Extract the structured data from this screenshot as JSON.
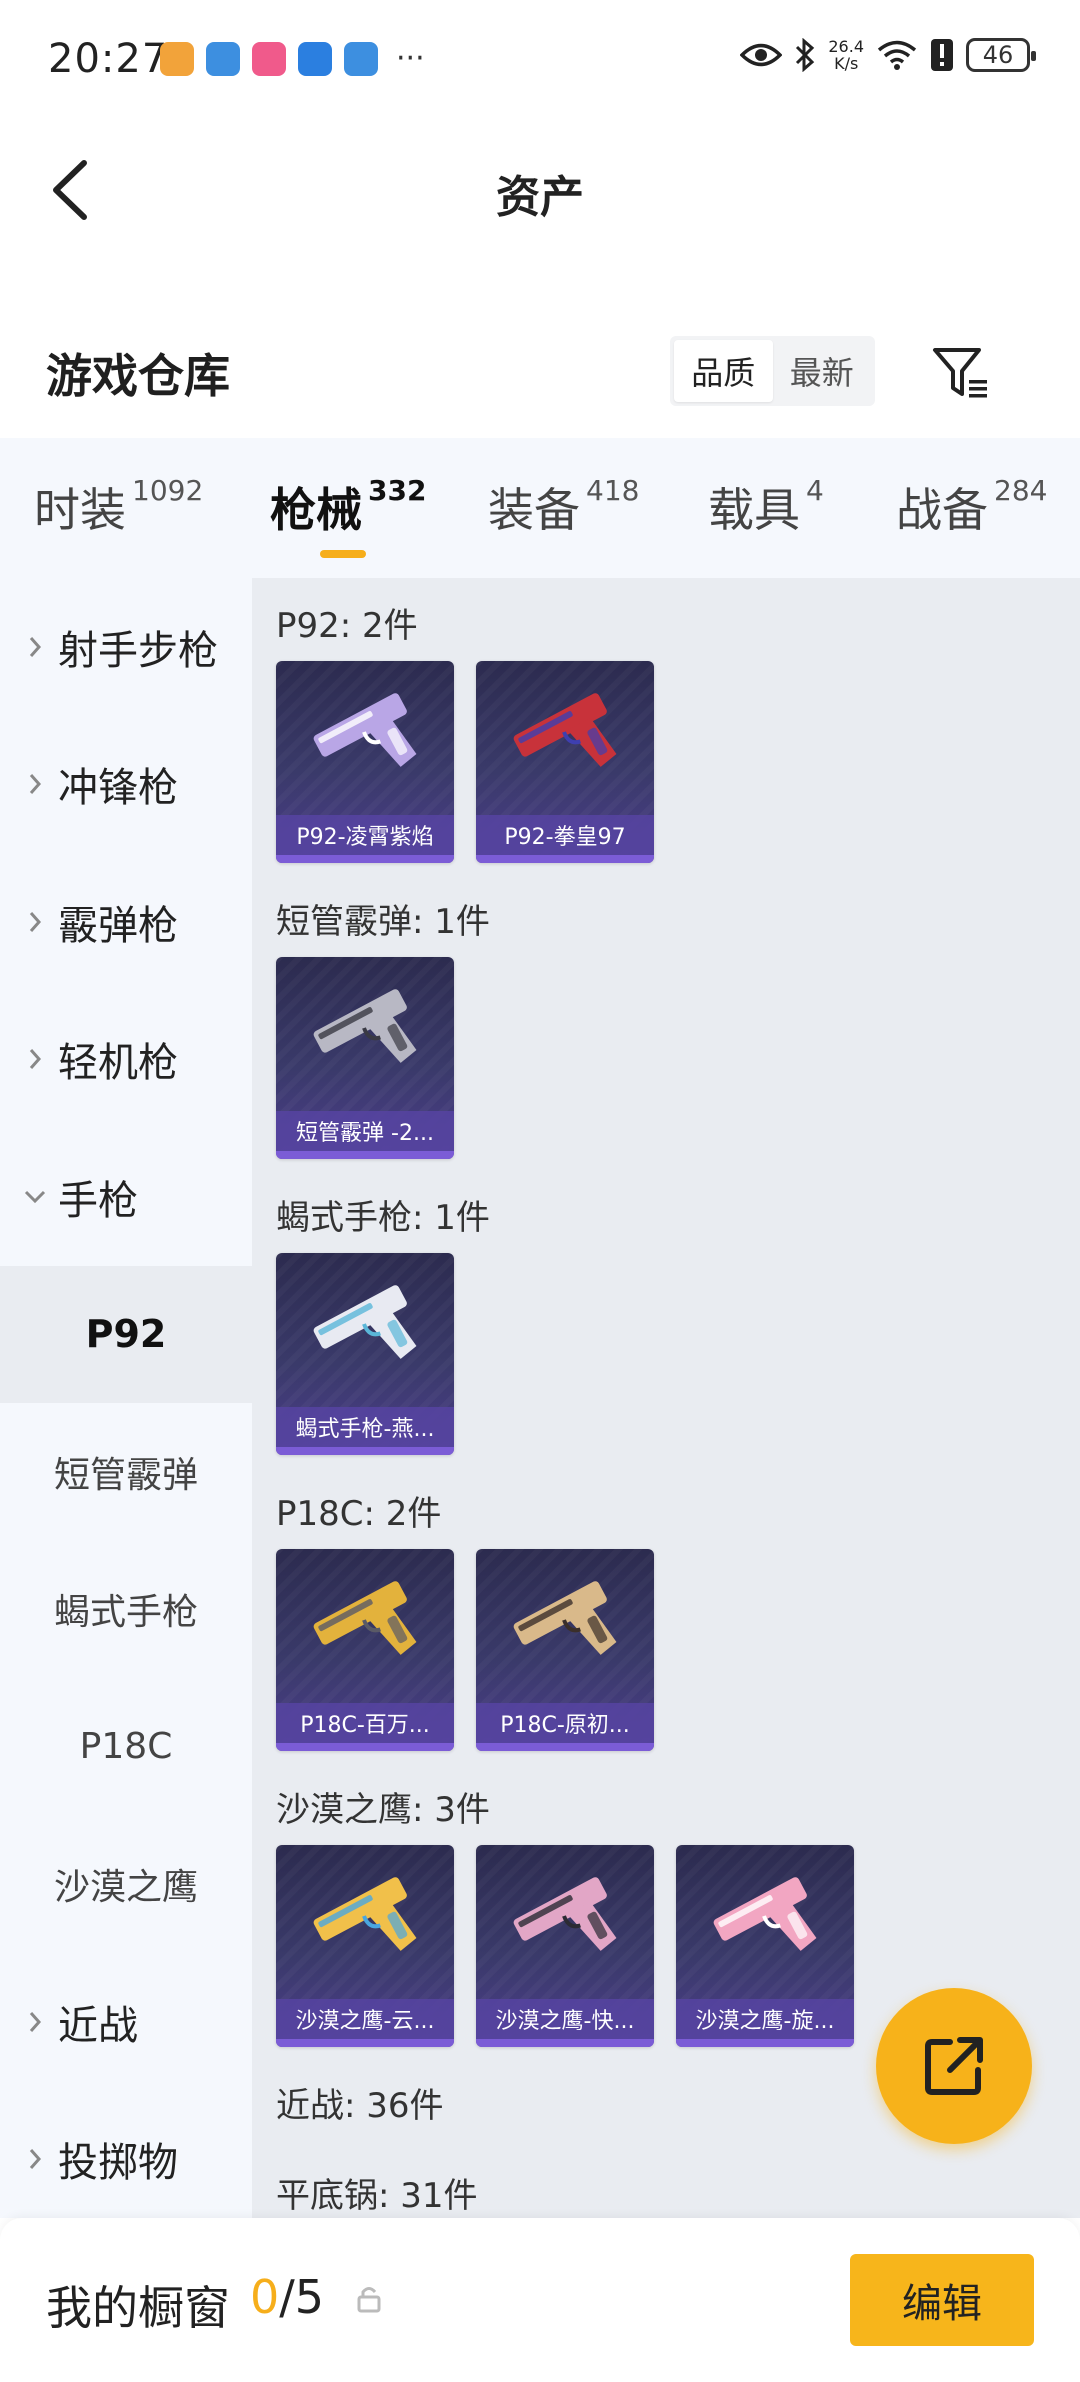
{
  "status_bar": {
    "time": "20:27",
    "more": "···",
    "net_speed_value": "26.4",
    "net_speed_unit": "K/s",
    "battery": "46",
    "app_icons": [
      {
        "name": "app-icon-1",
        "color": "#f2a33a"
      },
      {
        "name": "app-icon-2",
        "color": "#3d8fe0"
      },
      {
        "name": "app-icon-3",
        "color": "#f05a8b"
      },
      {
        "name": "bluetooth-app-icon",
        "color": "#2b7fe0"
      },
      {
        "name": "app-icon-5",
        "color": "#3d8fe0"
      }
    ]
  },
  "header": {
    "title": "资产"
  },
  "section": {
    "title": "游戏仓库",
    "sort_options": [
      "品质",
      "最新"
    ],
    "active_sort": 0
  },
  "tabs": [
    {
      "label": "时装",
      "count": "1092"
    },
    {
      "label": "枪械",
      "count": "332"
    },
    {
      "label": "装备",
      "count": "418"
    },
    {
      "label": "载具",
      "count": "4"
    },
    {
      "label": "战备",
      "count": "284"
    }
  ],
  "active_tab": 1,
  "sidebar": {
    "items": [
      {
        "type": "category",
        "label": "射手步枪",
        "expanded": false
      },
      {
        "type": "category",
        "label": "冲锋枪",
        "expanded": false
      },
      {
        "type": "category",
        "label": "霰弹枪",
        "expanded": false
      },
      {
        "type": "category",
        "label": "轻机枪",
        "expanded": false
      },
      {
        "type": "category",
        "label": "手枪",
        "expanded": true
      },
      {
        "type": "sub",
        "label": "P92",
        "active": true
      },
      {
        "type": "sub",
        "label": "短管霰弹",
        "active": false
      },
      {
        "type": "sub",
        "label": "蝎式手枪",
        "active": false
      },
      {
        "type": "sub",
        "label": "P18C",
        "active": false
      },
      {
        "type": "sub",
        "label": "沙漠之鹰",
        "active": false
      },
      {
        "type": "category",
        "label": "近战",
        "expanded": false
      },
      {
        "type": "category",
        "label": "投掷物",
        "expanded": false
      }
    ]
  },
  "groups": [
    {
      "title": "P92: 2件",
      "items": [
        {
          "name": "P92-凌霄紫焰",
          "gun_color": "#b9a6e6",
          "accent": "#ffffff"
        },
        {
          "name": "P92-拳皇97",
          "gun_color": "#c8323a",
          "accent": "#3e3fb0"
        }
      ]
    },
    {
      "title": "短管霰弹: 1件",
      "items": [
        {
          "name": "短管霰弹 -2...",
          "gun_color": "#b8b8c4",
          "accent": "#3a3a44"
        }
      ]
    },
    {
      "title": "蝎式手枪: 1件",
      "items": [
        {
          "name": "蝎式手枪-燕...",
          "gun_color": "#e8eaf2",
          "accent": "#5ab6d8"
        }
      ]
    },
    {
      "title": "P18C: 2件",
      "items": [
        {
          "name": "P18C-百万...",
          "gun_color": "#e3b23c",
          "accent": "#5a5a66"
        },
        {
          "name": "P18C-原初...",
          "gun_color": "#d9b98a",
          "accent": "#3b2f2a"
        }
      ]
    },
    {
      "title": "沙漠之鹰: 3件",
      "items": [
        {
          "name": "沙漠之鹰-云...",
          "gun_color": "#f1c04a",
          "accent": "#4aa6e0"
        },
        {
          "name": "沙漠之鹰-快...",
          "gun_color": "#e2a6c6",
          "accent": "#2b2b33"
        },
        {
          "name": "沙漠之鹰-旋...",
          "gun_color": "#f2a6c2",
          "accent": "#ffffff"
        }
      ]
    },
    {
      "title": "近战: 36件",
      "items": []
    },
    {
      "title": "平底锅: 31件",
      "items": []
    }
  ],
  "bottom_bar": {
    "title": "我的橱窗",
    "current": "0",
    "total": "/5",
    "edit_label": "编辑"
  },
  "colors": {
    "accent": "#f6ae1b",
    "sidebar_bg": "#f5f8fd",
    "content_bg": "#e9ecf1",
    "card_label_bg": "#5544a0"
  }
}
